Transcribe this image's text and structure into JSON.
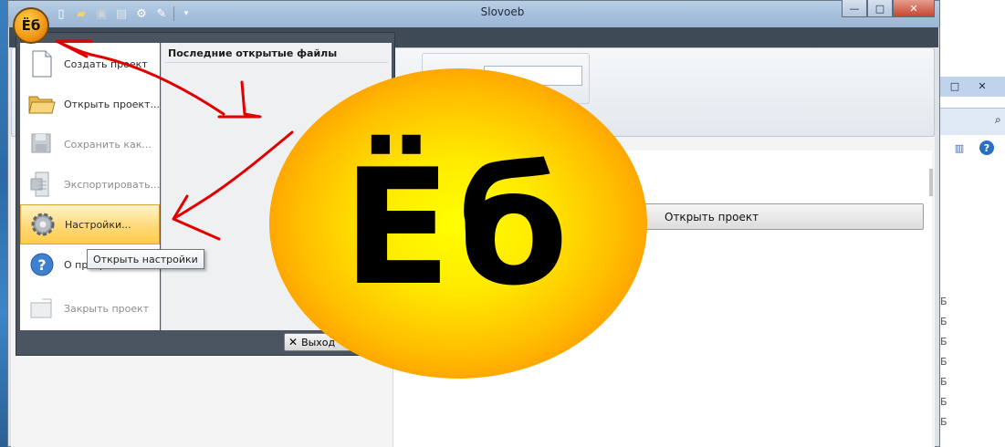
{
  "window": {
    "title": "Slovoeb",
    "controls": {
      "minimize": "—",
      "maximize": "□",
      "close": "✕"
    }
  },
  "app_button": {
    "label": "Ёб"
  },
  "quick_access": [
    "new-file-icon",
    "open-folder-icon",
    "save-icon",
    "export-icon",
    "settings-icon",
    "tools-icon",
    "dropdown-icon"
  ],
  "menu": {
    "items": [
      {
        "label": "Создать проект",
        "icon": "new-document-icon",
        "enabled": true
      },
      {
        "label": "Открыть проект...",
        "icon": "folder-open-icon",
        "enabled": true
      },
      {
        "label": "Сохранить как...",
        "icon": "save-as-icon",
        "enabled": false
      },
      {
        "label": "Экспортировать...",
        "icon": "export-icon",
        "enabled": false
      },
      {
        "label": "Настройки...",
        "icon": "gear-icon",
        "enabled": true,
        "highlighted": true
      },
      {
        "label": "О программе",
        "icon": "help-icon",
        "enabled": true
      },
      {
        "label": "Закрыть проект",
        "icon": "close-project-icon",
        "enabled": false
      }
    ],
    "recent_title": "Последние открытые файлы",
    "exit_label": "Выход"
  },
  "tooltip": "Открыть настройки",
  "content": {
    "open_project_button": "Открыть проект"
  },
  "logo": {
    "text": "Ёб",
    "colors": {
      "center": "#ffff00",
      "edge": "#ff7a00"
    }
  },
  "second_window": {
    "controls": {
      "maximize": "□",
      "close": "✕"
    },
    "side_items": [
      "Б",
      "Б",
      "Б",
      "Б",
      "Б",
      "Б",
      "Б"
    ]
  },
  "annotation": {
    "arrow_color": "#e00000"
  }
}
